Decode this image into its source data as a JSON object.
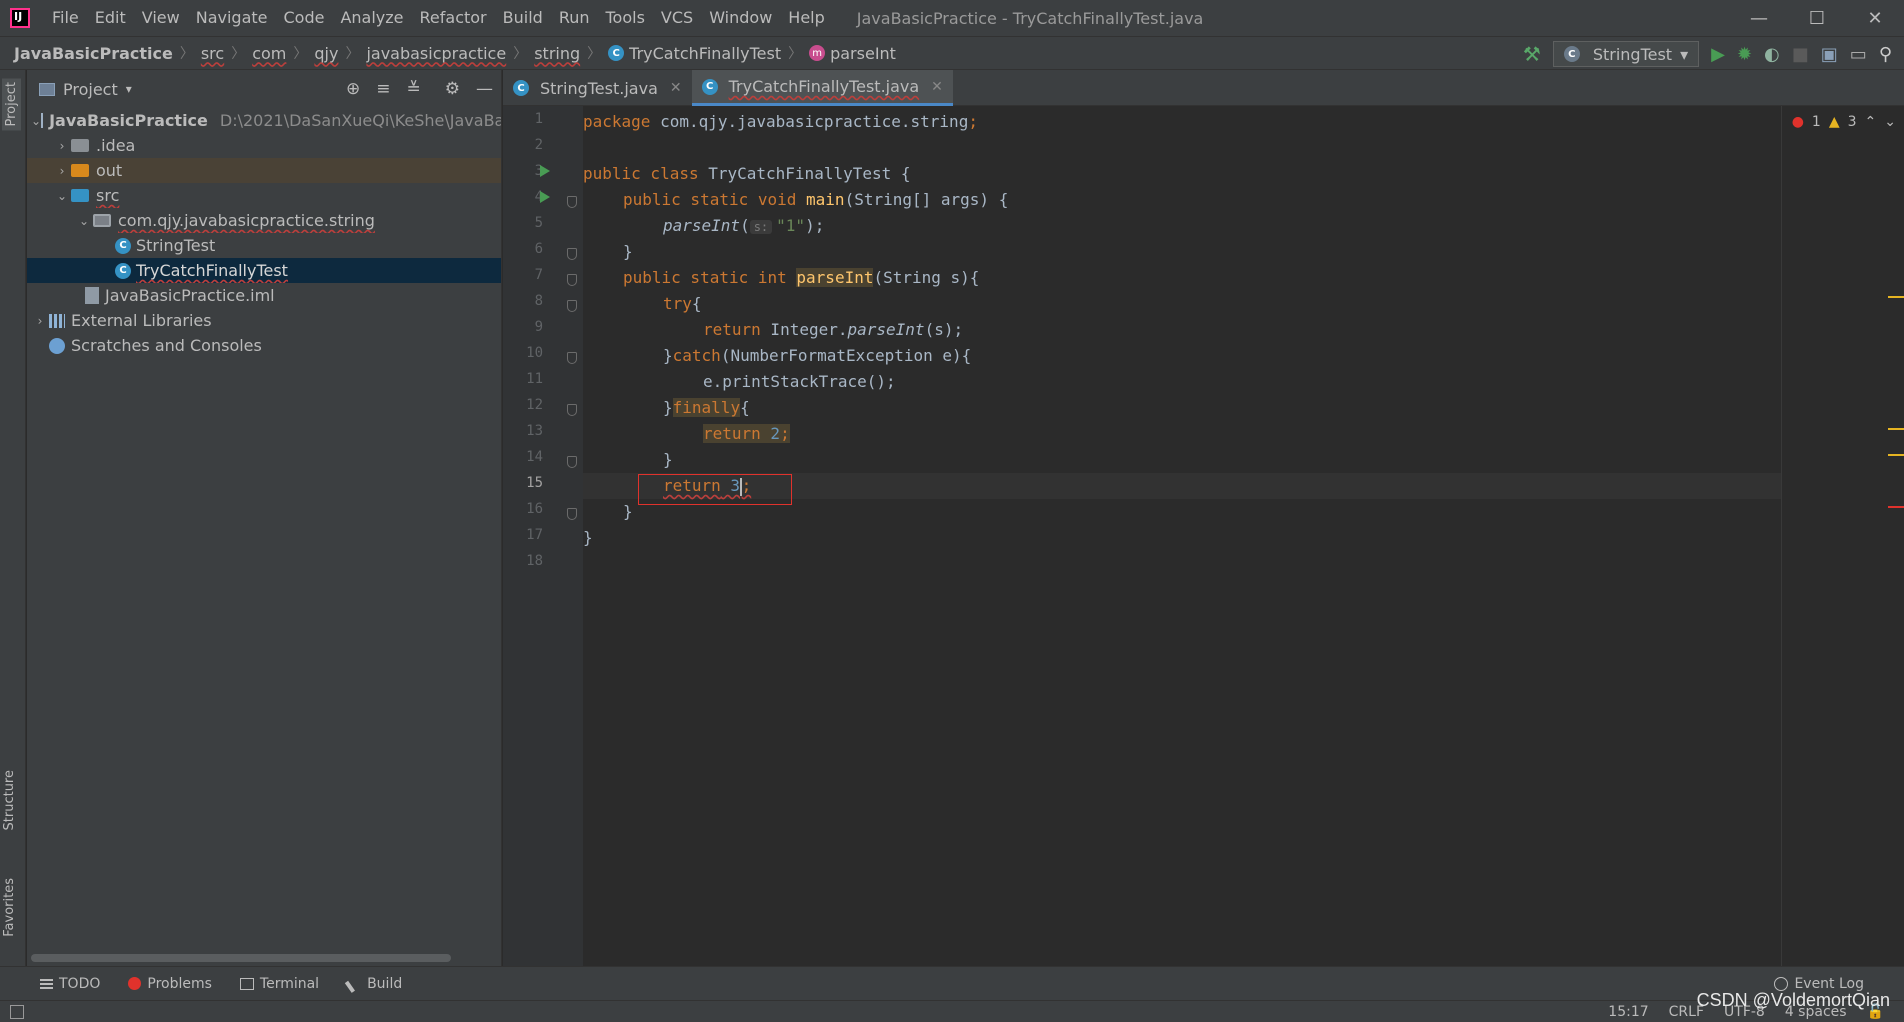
{
  "titlebar": {
    "menu": [
      "File",
      "Edit",
      "View",
      "Navigate",
      "Code",
      "Analyze",
      "Refactor",
      "Build",
      "Run",
      "Tools",
      "VCS",
      "Window",
      "Help"
    ],
    "window_title": "JavaBasicPractice - TryCatchFinallyTest.java",
    "minimize": "—",
    "maximize": "☐",
    "close": "✕"
  },
  "breadcrumbs": {
    "items": [
      "JavaBasicPractice",
      "src",
      "com",
      "qjy",
      "javabasicpractice",
      "string",
      "TryCatchFinallyTest",
      "parseInt"
    ],
    "separator": "〉"
  },
  "run_config": {
    "name": "StringTest",
    "arrow": "▾"
  },
  "project_panel": {
    "title": "Project",
    "arrow": "▾",
    "tree": {
      "root": {
        "name": "JavaBasicPractice",
        "path": "D:\\2021\\DaSanXueQi\\KeShe\\JavaBasicPractice"
      },
      "idea": ".idea",
      "out": "out",
      "src": "src",
      "package": "com.qjy.javabasicpractice.string",
      "file1": "StringTest",
      "file2": "TryCatchFinallyTest",
      "iml": "JavaBasicPractice.iml",
      "libs": "External Libraries",
      "scratches": "Scratches and Consoles"
    }
  },
  "tool_stripe": {
    "project": "Project",
    "structure": "Structure",
    "favorites": "Favorites"
  },
  "editor": {
    "tabs": [
      {
        "label": "StringTest.java",
        "close": "✕"
      },
      {
        "label": "TryCatchFinallyTest.java",
        "close": "✕"
      }
    ],
    "line_numbers": [
      "1",
      "2",
      "3",
      "4",
      "5",
      "6",
      "7",
      "8",
      "9",
      "10",
      "11",
      "12",
      "13",
      "14",
      "15",
      "16",
      "17",
      "18"
    ],
    "code": {
      "l1_kw": "package",
      "l1_rest": " com.qjy.javabasicpractice.string",
      "l1_semi": ";",
      "l3_kw": "public class",
      "l3_rest": " TryCatchFinallyTest {",
      "l4_kw": "public static void",
      "l4_fn": "main",
      "l4_rest": "(String[] args) {",
      "l5_fn": "parseInt",
      "l5_open": "(",
      "l5_hint": "s:",
      "l5_str": "\"1\"",
      "l5_close": ");",
      "l6": "}",
      "l7_kw": "public static int",
      "l7_fn": "parseInt",
      "l7_rest": "(String s){",
      "l8_kw": "try",
      "l8_rest": "{",
      "l9_kw": "return",
      "l9_rest": " Integer.",
      "l9_fn": "parseInt",
      "l9_end": "(s);",
      "l10_a": "}",
      "l10_kw": "catch",
      "l10_rest": "(NumberFormatException e){",
      "l11": "e.printStackTrace();",
      "l12_a": "}",
      "l12_kw": "finally",
      "l12_rest": "{",
      "l13_kw": "return",
      "l13_num": " 2",
      "l13_semi": ";",
      "l14": "}",
      "l15_kw": "return",
      "l15_num_a": " 3",
      "l15_semi": ";",
      "l16": "}",
      "l17": "}"
    },
    "inspection": {
      "errors": "1",
      "warnings": "3",
      "up": "⌃",
      "down": "⌄"
    }
  },
  "bottom_tools": {
    "todo": "TODO",
    "problems": "Problems",
    "terminal": "Terminal",
    "build": "Build",
    "event_log": "Event Log"
  },
  "status": {
    "position": "15:17",
    "line_sep": "CRLF",
    "encoding": "UTF-8",
    "indent": "4 spaces"
  },
  "watermark": "CSDN @VoldemortQian",
  "colors": {
    "keyword": "#cc7832",
    "function": "#ffc66d",
    "string": "#6a8759",
    "number": "#6897bb",
    "error": "#e0322c",
    "warning": "#e6b422",
    "accent": "#4a88c7"
  }
}
